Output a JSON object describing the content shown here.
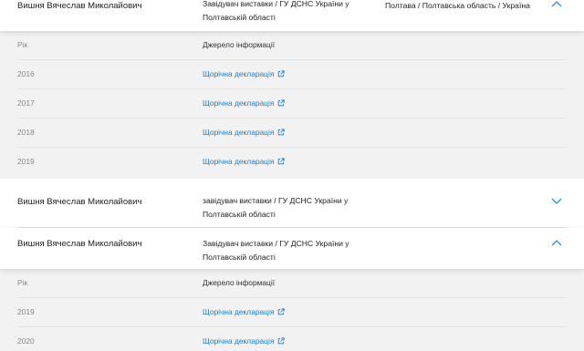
{
  "rows": [
    {
      "name": "Вишня Вячеслав Миколайович",
      "position": "Завідувач виставки / ГУ ДСНС України у Полтавській області",
      "location": "Полтава / Полтавська область / Україна",
      "expanded": true
    },
    {
      "name": "Вишня Вячеслав Миколайович",
      "position": "завідувач виставки / ГУ ДСНС України у Полтавській області",
      "location": "",
      "expanded": false
    },
    {
      "name": "Вишня Вячеслав Миколайович",
      "position": "Завідувач виставки / ГУ ДСНС України у Полтавській області",
      "location": "",
      "expanded": true
    }
  ],
  "details_headers": {
    "year": "Рік",
    "source": "Джерело інформації"
  },
  "details_1": [
    {
      "year": "2016",
      "source": "Щорічна декларація"
    },
    {
      "year": "2017",
      "source": "Щорічна декларація"
    },
    {
      "year": "2018",
      "source": "Щорічна декларація"
    },
    {
      "year": "2019",
      "source": "Щорічна декларація"
    }
  ],
  "details_2": [
    {
      "year": "2019",
      "source": "Щорічна декларація"
    },
    {
      "year": "2020",
      "source": "Щорічна декларація"
    }
  ],
  "icons": {
    "expanded": "chevron-up-icon",
    "collapsed": "chevron-down-icon",
    "link": "external-link-icon"
  },
  "colors": {
    "link": "#1a7fc9",
    "details_bg": "#f2f2f2",
    "chevron": "#2e8fd8"
  }
}
